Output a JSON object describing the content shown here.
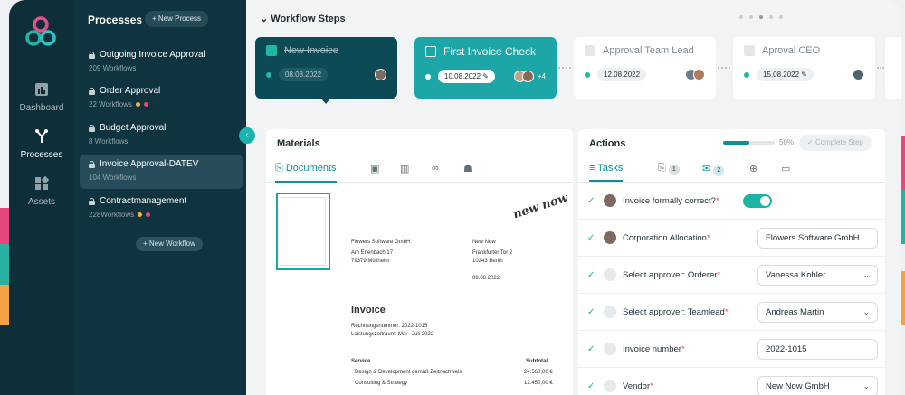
{
  "sidebar": {
    "title": "Processes",
    "new_process": "+ New Process",
    "processes": [
      {
        "name": "Outgoing Invoice Approval",
        "count": "209 Workflows"
      },
      {
        "name": "Order Approval",
        "count": "22 Workflows"
      },
      {
        "name": "Budget Approval",
        "count": "8 Workflows"
      },
      {
        "name": "Invoice Approval-DATEV",
        "count": "104 Workflows"
      },
      {
        "name": "Contractmanagement",
        "count": "228Workflows"
      }
    ],
    "new_workflow": "+ New Workflow"
  },
  "rail": {
    "dashboard": "Dashboard",
    "processes": "Processes",
    "assets": "Assets"
  },
  "workflow": {
    "title": "Workflow Steps",
    "steps": [
      {
        "name": "New Invoice",
        "date": "08.08.2022"
      },
      {
        "name": "First Invoice Check",
        "date": "10.08.2022",
        "extra": "+4"
      },
      {
        "name": "Approval Team Lead",
        "date": "12.08.2022"
      },
      {
        "name": "Aproval CEO",
        "date": "15.08.2022"
      }
    ]
  },
  "materials": {
    "title": "Materials",
    "tab": "Documents",
    "doc": {
      "from_name": "Flowers Software GmbH",
      "from_street": "Am Erlenbach 17",
      "from_city": "79379 Müllheim",
      "to_name": "New Now",
      "to_street": "Frankfurter Tor 2",
      "to_city": "10243 Berlin",
      "date": "08.08.2022",
      "heading": "Invoice",
      "meta1": "Rechnungsnummer: 2022-1015",
      "meta2": "Leistungszeitraum: Mai - Juli 2022",
      "col1": "Service",
      "col2": "Subtotal",
      "r1": "Design & Development gemäß Zeitnachweis",
      "r1v": "24.560,00 €",
      "r2": "Consulting & Strategy",
      "r2v": "12.450,00 €",
      "logo": "new now"
    }
  },
  "actions": {
    "title": "Actions",
    "progress": 0.5,
    "progress_label": "50%",
    "complete": "Complete Step",
    "tasks_tab": "Tasks",
    "attach_count": "1",
    "mail_count": "2",
    "tasks": [
      {
        "label": "Invoice formally correct?",
        "type": "toggle"
      },
      {
        "label": "Corporation Allocation",
        "value": "Flowers Software GmbH"
      },
      {
        "label": "Select approver: Orderer",
        "value": "Vanessa Kohler",
        "select": true
      },
      {
        "label": "Select approver: Teamlead",
        "value": "Andreas Martin",
        "select": true
      },
      {
        "label": "Invoice number",
        "value": "2022-1015"
      },
      {
        "label": "Vendor",
        "value": "New Now GmbH",
        "select": true
      }
    ]
  },
  "colors": {
    "accent": "#0e8f96",
    "teal": "#19b3b0",
    "dark": "#0e2f3a"
  }
}
